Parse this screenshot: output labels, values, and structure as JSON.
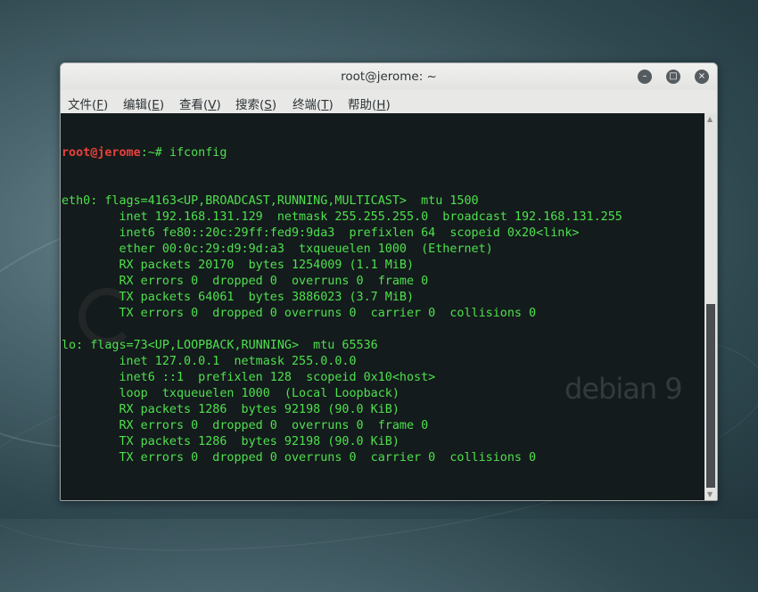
{
  "window": {
    "title": "root@jerome: ~",
    "buttons": {
      "minimize": "–",
      "maximize": "□",
      "close": "×"
    }
  },
  "menu": [
    {
      "label": "文件(",
      "key": "F",
      "end": ")"
    },
    {
      "label": "编辑(",
      "key": "E",
      "end": ")"
    },
    {
      "label": "查看(",
      "key": "V",
      "end": ")"
    },
    {
      "label": "搜索(",
      "key": "S",
      "end": ")"
    },
    {
      "label": "终端(",
      "key": "T",
      "end": ")"
    },
    {
      "label": "帮助(",
      "key": "H",
      "end": ")"
    }
  ],
  "prompt": {
    "user_host": "root@jerome",
    "suffix": ":~# "
  },
  "command": "ifconfig",
  "output": [
    "eth0: flags=4163<UP,BROADCAST,RUNNING,MULTICAST>  mtu 1500",
    "        inet 192.168.131.129  netmask 255.255.255.0  broadcast 192.168.131.255",
    "        inet6 fe80::20c:29ff:fed9:9da3  prefixlen 64  scopeid 0x20<link>",
    "        ether 00:0c:29:d9:9d:a3  txqueuelen 1000  (Ethernet)",
    "        RX packets 20170  bytes 1254009 (1.1 MiB)",
    "        RX errors 0  dropped 0  overruns 0  frame 0",
    "        TX packets 64061  bytes 3886023 (3.7 MiB)",
    "        TX errors 0  dropped 0 overruns 0  carrier 0  collisions 0",
    "",
    "lo: flags=73<UP,LOOPBACK,RUNNING>  mtu 65536",
    "        inet 127.0.0.1  netmask 255.0.0.0",
    "        inet6 ::1  prefixlen 128  scopeid 0x10<host>",
    "        loop  txqueuelen 1000  (Local Loopback)",
    "        RX packets 1286  bytes 92198 (90.0 KiB)",
    "        RX errors 0  dropped 0  overruns 0  frame 0",
    "        TX packets 1286  bytes 92198 (90.0 KiB)",
    "        TX errors 0  dropped 0 overruns 0  carrier 0  collisions 0",
    ""
  ],
  "watermark": "debian 9",
  "colors": {
    "prompt": "#e8413b",
    "text": "#4ee04e",
    "terminal_bg": "#141b1c"
  }
}
